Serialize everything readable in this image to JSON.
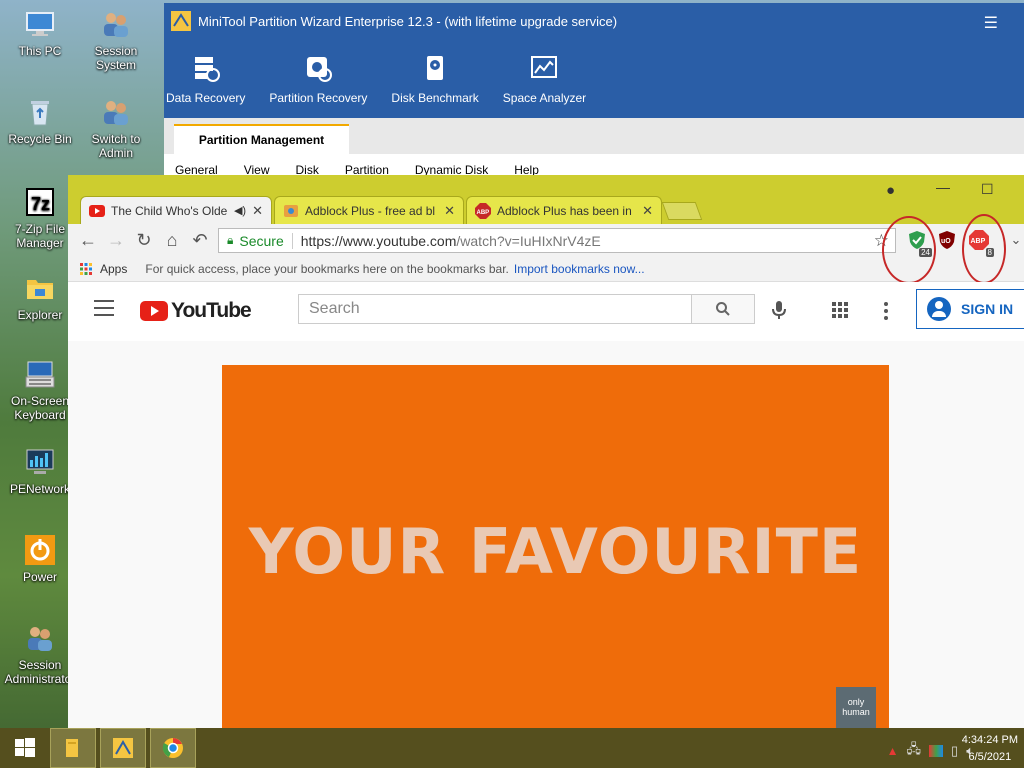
{
  "desktop": {
    "icons": [
      {
        "label": "This PC"
      },
      {
        "label": "Session System"
      },
      {
        "label": "Recycle Bin"
      },
      {
        "label": "Switch to Admin"
      },
      {
        "label": "7-Zip File Manager"
      },
      {
        "label": "Explorer"
      },
      {
        "label": "On-Screen Keyboard"
      },
      {
        "label": "PENetwork"
      },
      {
        "label": "Power"
      },
      {
        "label": "Session Administrator"
      }
    ]
  },
  "minitool": {
    "title": "MiniTool Partition Wizard Enterprise 12.3 - (with lifetime upgrade service)",
    "tools": [
      {
        "label": "Data Recovery"
      },
      {
        "label": "Partition Recovery"
      },
      {
        "label": "Disk Benchmark"
      },
      {
        "label": "Space Analyzer"
      }
    ],
    "active_tab": "Partition Management",
    "menu": [
      "General",
      "View",
      "Disk",
      "Partition",
      "Dynamic Disk",
      "Help"
    ]
  },
  "chrome": {
    "tabs": [
      {
        "title": "The Child Who's Olde"
      },
      {
        "title": "Adblock Plus - free ad bl"
      },
      {
        "title": "Adblock Plus has been in"
      }
    ],
    "security_label": "Secure",
    "url_host": "https://www.youtube.com",
    "url_path": "/watch?v=IuHIxNrV4zE",
    "extensions": [
      {
        "name": "shield-extension",
        "badge": "24"
      },
      {
        "name": "ublock-extension",
        "badge": ""
      },
      {
        "name": "adblock-plus-extension",
        "badge": "8"
      }
    ],
    "bookmarks": {
      "apps_label": "Apps",
      "hint": "For quick access, place your bookmarks here on the bookmarks bar.",
      "import_link": "Import bookmarks now..."
    }
  },
  "youtube": {
    "logo_text": "YouTube",
    "search_placeholder": "Search",
    "sign_in": "SIGN IN",
    "video_headline": "YOUR FAVOURITE",
    "video_brand": "only human"
  },
  "taskbar": {
    "time": "4:34:24 PM",
    "date": "6/5/2021"
  }
}
